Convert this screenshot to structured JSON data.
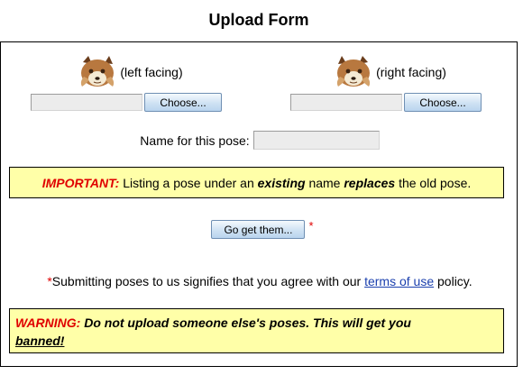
{
  "form": {
    "title": "Upload Form"
  },
  "left_pose": {
    "label": "(left facing)",
    "choose_label": "Choose..."
  },
  "right_pose": {
    "label": "(right facing)",
    "choose_label": "Choose..."
  },
  "name_field": {
    "label": "Name for this pose:",
    "value": ""
  },
  "important_notice": {
    "prefix": "IMPORTANT:",
    "text1": "Listing a pose under an",
    "em1": "existing",
    "text2": "name",
    "em2": "replaces",
    "text3": "the old pose."
  },
  "submit": {
    "label": "Go get them...",
    "asterisk": "*"
  },
  "agreement": {
    "star": "*",
    "text_before": "Submitting poses to us signifies that you agree with our",
    "link": "terms of use",
    "text_after": "policy."
  },
  "warning": {
    "prefix": "WARNING:",
    "message": "Do not upload someone else's poses. This will get you",
    "emphasis": "banned!"
  },
  "colors": {
    "notice_bg": "#ffffa8",
    "alert_red": "#e00000",
    "link_blue": "#1a3fae"
  },
  "icons": {
    "pose_icon": "wolf-head-icon"
  }
}
